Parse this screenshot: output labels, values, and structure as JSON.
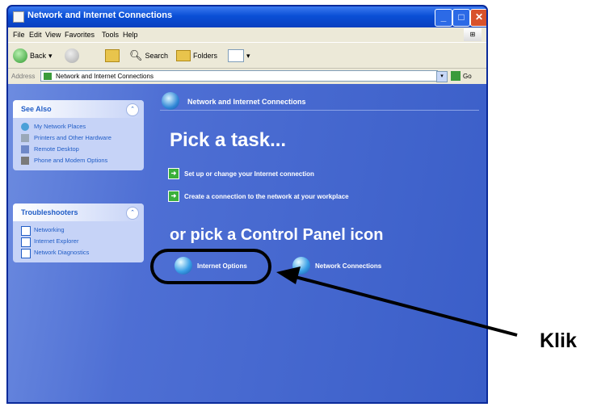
{
  "window": {
    "title": "Network and Internet Connections"
  },
  "menu": [
    "File",
    "Edit",
    "View",
    "Favorites",
    "Tools",
    "Help"
  ],
  "toolbar": {
    "back": "Back",
    "search": "Search",
    "folders": "Folders"
  },
  "address": {
    "label": "Address",
    "value": "Network and Internet Connections",
    "go": "Go"
  },
  "see_also": {
    "title": "See Also",
    "items": [
      "My Network Places",
      "Printers and Other Hardware",
      "Remote Desktop",
      "Phone and Modem Options"
    ]
  },
  "troubleshooters": {
    "title": "Troubleshooters",
    "items": [
      "Networking",
      "Internet Explorer",
      "Network Diagnostics"
    ]
  },
  "main": {
    "header": "Network and Internet Connections",
    "pick_task": "Pick a task...",
    "tasks": [
      "Set up or change your Internet connection",
      "Create a connection to the network at your workplace"
    ],
    "or_pick": "or pick a Control Panel icon",
    "icons": [
      "Internet Options",
      "Network Connections"
    ]
  },
  "annotation": {
    "label": "Klik"
  }
}
